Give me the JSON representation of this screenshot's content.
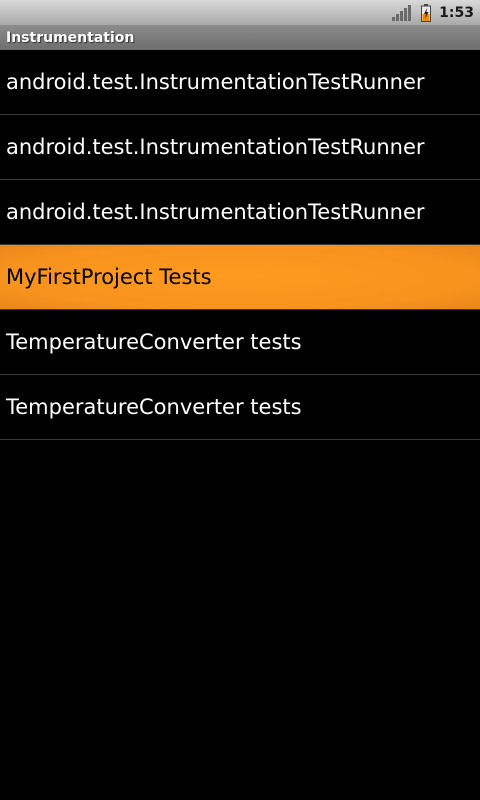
{
  "status_bar": {
    "time": "1:53",
    "signal_icon": "signal-bars-icon",
    "battery_icon": "battery-charging-icon"
  },
  "title_bar": {
    "title": "Instrumentation"
  },
  "list": {
    "selected_index": 3,
    "items": [
      {
        "label": "android.test.InstrumentationTestRunner"
      },
      {
        "label": "android.test.InstrumentationTestRunner"
      },
      {
        "label": "android.test.InstrumentationTestRunner"
      },
      {
        "label": "MyFirstProject Tests"
      },
      {
        "label": "TemperatureConverter tests"
      },
      {
        "label": "TemperatureConverter tests"
      }
    ]
  },
  "colors": {
    "highlight": "#f7931e",
    "background": "#000000",
    "divider": "#3a3a3a"
  }
}
